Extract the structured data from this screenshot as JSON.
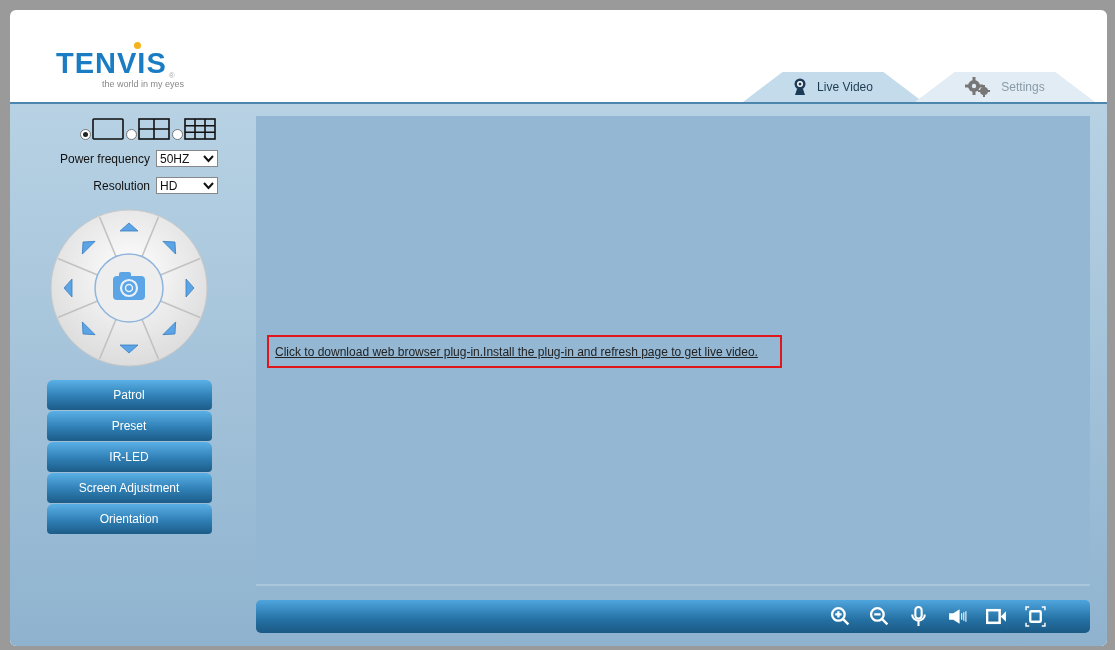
{
  "logo": {
    "name": "TENVIS",
    "mark": "®",
    "tagline": "the world in my eyes"
  },
  "tabs": [
    {
      "label": "Live Video",
      "selected": true,
      "kind": "webcam"
    },
    {
      "label": "Settings",
      "selected": false,
      "kind": "gears"
    }
  ],
  "layouts": [
    {
      "kind": "single",
      "selected": true
    },
    {
      "kind": "quad",
      "selected": false
    },
    {
      "kind": "nine",
      "selected": false
    }
  ],
  "settings": [
    {
      "label": "Power frequency",
      "value": "50HZ"
    },
    {
      "label": "Resolution",
      "value": "HD"
    }
  ],
  "menu_buttons": [
    "Patrol",
    "Preset",
    "IR-LED",
    "Screen Adjustment",
    "Orientation"
  ],
  "video": {
    "message": "Click to download web browser plug-in.Install the plug-in and refresh page to get live video."
  },
  "toolbar": [
    {
      "kind": "zoom_in"
    },
    {
      "kind": "zoom_out"
    },
    {
      "kind": "mic"
    },
    {
      "kind": "speaker"
    },
    {
      "kind": "record"
    },
    {
      "kind": "fullscreen"
    }
  ]
}
